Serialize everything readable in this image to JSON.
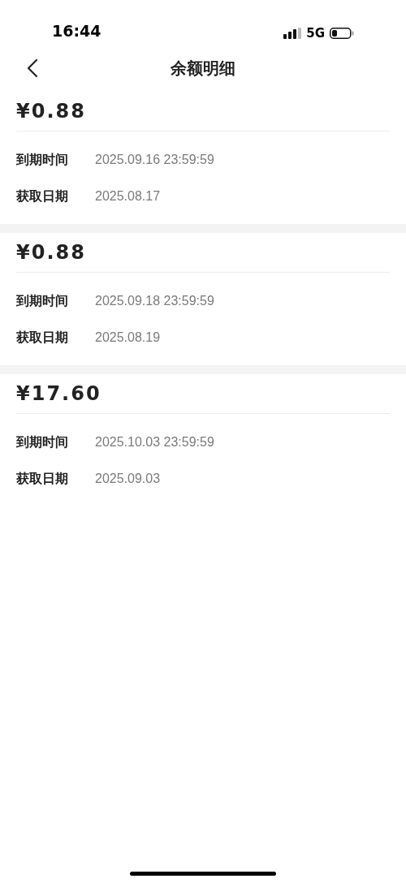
{
  "status_bar": {
    "time": "16:44",
    "network": "5G"
  },
  "nav": {
    "title": "余额明细"
  },
  "records": [
    {
      "amount": "¥0.88",
      "fields": [
        {
          "label": "到期时间",
          "value": "2025.09.16 23:59:59"
        },
        {
          "label": "获取日期",
          "value": "2025.08.17"
        }
      ]
    },
    {
      "amount": "¥0.88",
      "fields": [
        {
          "label": "到期时间",
          "value": "2025.09.18 23:59:59"
        },
        {
          "label": "获取日期",
          "value": "2025.08.19"
        }
      ]
    },
    {
      "amount": "¥17.60",
      "fields": [
        {
          "label": "到期时间",
          "value": "2025.10.03 23:59:59"
        },
        {
          "label": "获取日期",
          "value": "2025.09.03"
        }
      ]
    }
  ]
}
